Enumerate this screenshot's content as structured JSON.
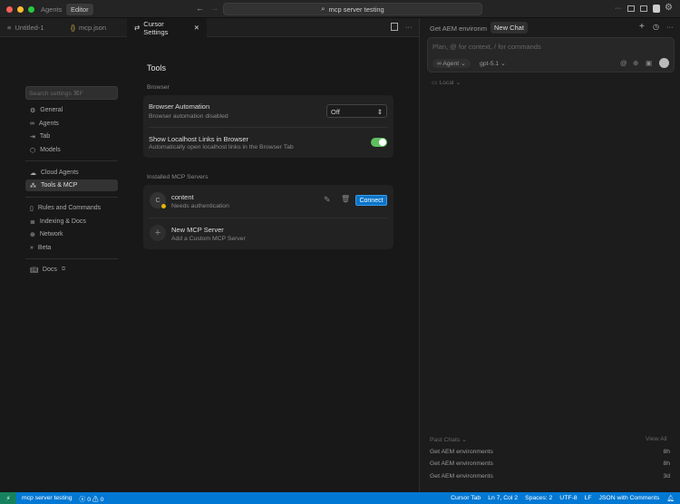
{
  "titlebar": {
    "agents": "Agents",
    "editor": "Editor",
    "search": "mcp server testing"
  },
  "tabs": [
    {
      "label": "Untitled-1"
    },
    {
      "label": "mcp.json"
    },
    {
      "label": "Cursor Settings"
    }
  ],
  "settings": {
    "search_placeholder": "Search settings ⌘F",
    "nav": [
      "General",
      "Agents",
      "Tab",
      "Models",
      "Cloud Agents",
      "Tools & MCP",
      "Rules and Commands",
      "Indexing & Docs",
      "Network",
      "Beta",
      "Docs"
    ],
    "selected": "Tools & MCP",
    "title": "Tools",
    "browser_section": "Browser",
    "browser_automation": {
      "label": "Browser Automation",
      "desc": "Browser automation disabled",
      "value": "Off"
    },
    "localhost": {
      "label": "Show Localhost Links in Browser",
      "desc": "Automatically open localhost links in the Browser Tab",
      "enabled": true
    },
    "mcp_section": "Installed MCP Servers",
    "server": {
      "initial": "C",
      "name": "content",
      "status": "Needs authentication",
      "status_color": "#e5b20b",
      "connect": "Connect"
    },
    "new_server": {
      "label": "New MCP Server",
      "desc": "Add a Custom MCP Server"
    }
  },
  "chat": {
    "tab1": "Get AEM environm",
    "tab2": "New Chat",
    "placeholder": "Plan, @ for context, / for commands",
    "mode": "Agent",
    "model": "gpt-5.1",
    "location": "Local",
    "past_label": "Past Chats",
    "view_all": "View All",
    "past": [
      {
        "title": "Get AEM environments",
        "age": "8h"
      },
      {
        "title": "Get AEM environments",
        "age": "8h"
      },
      {
        "title": "Get AEM environments",
        "age": "3d"
      }
    ]
  },
  "status": {
    "remote": "mcp server testing",
    "errors": "0",
    "warnings": "0",
    "cursor_tab": "Cursor Tab",
    "position": "Ln 7, Col 2",
    "spaces": "Spaces: 2",
    "encoding": "UTF-8",
    "eol": "LF",
    "language": "JSON with Comments"
  },
  "colors": {
    "accent": "#0078d4",
    "toggle": "#5fbf5f"
  }
}
